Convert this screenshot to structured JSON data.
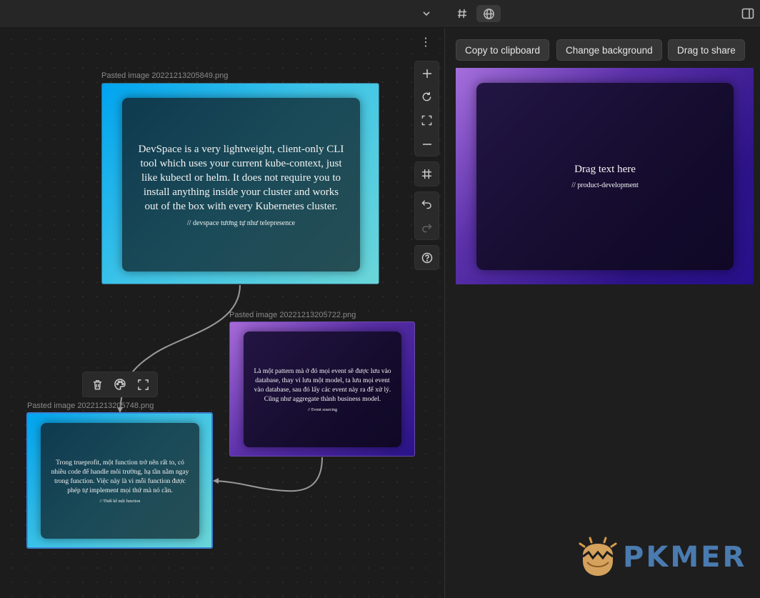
{
  "toolbar": {
    "icons": [
      "chevron-down-icon",
      "hash-icon",
      "globe-icon",
      "sidebar-toggle-icon"
    ]
  },
  "canvas": {
    "nodes": [
      {
        "label": "Pasted image 20221213205849.png",
        "text": "DevSpace is a very lightweight, client-only CLI tool which uses your current kube-context, just like kubectl or helm. It does not require you to install anything inside your cluster and works out of the box with every Kubernetes cluster.",
        "tag": "// devspace tương tự như telepresence",
        "background": "cyan"
      },
      {
        "label": "Pasted image 20221213205722.png",
        "text": "Là một pattern mà ở đó mọi event sẽ được lưu vào database, thay vì lưu một model, ta lưu mọi event vào database, sau đó lấy các event này ra để xử lý. Cũng như aggregate thành business model.",
        "tag": "// Event sourcing",
        "background": "purple"
      },
      {
        "label": "Pasted image 20221213205748.png",
        "text": "Trong trueprofit, một function trở nên rất to, có nhiều code để handle môi trường, hạ tần nằm ngay trong function. Việc này là vì mỗi function được phép tự implement mọi thứ mà nó cần.",
        "tag": "// Thiết kế một function",
        "background": "cyan",
        "selected": true
      }
    ],
    "controls": [
      "zoom-in-icon",
      "reset-icon",
      "fit-icon",
      "zoom-out-icon",
      "grid-icon",
      "undo-icon",
      "redo-icon",
      "help-icon"
    ],
    "node_toolbar": [
      "trash-icon",
      "palette-icon",
      "zoom-to-node-icon"
    ]
  },
  "share_panel": {
    "buttons": {
      "copy": "Copy to clipboard",
      "background": "Change background",
      "drag": "Drag to share"
    },
    "preview": {
      "title": "Drag text here",
      "tag": "// product-development"
    }
  },
  "watermark": {
    "text": "PKMER"
  },
  "colors": {
    "accent_selected": "#3b82d6",
    "cyan_gradient": "#00a4f0",
    "purple_gradient": "#5a2fa8"
  }
}
